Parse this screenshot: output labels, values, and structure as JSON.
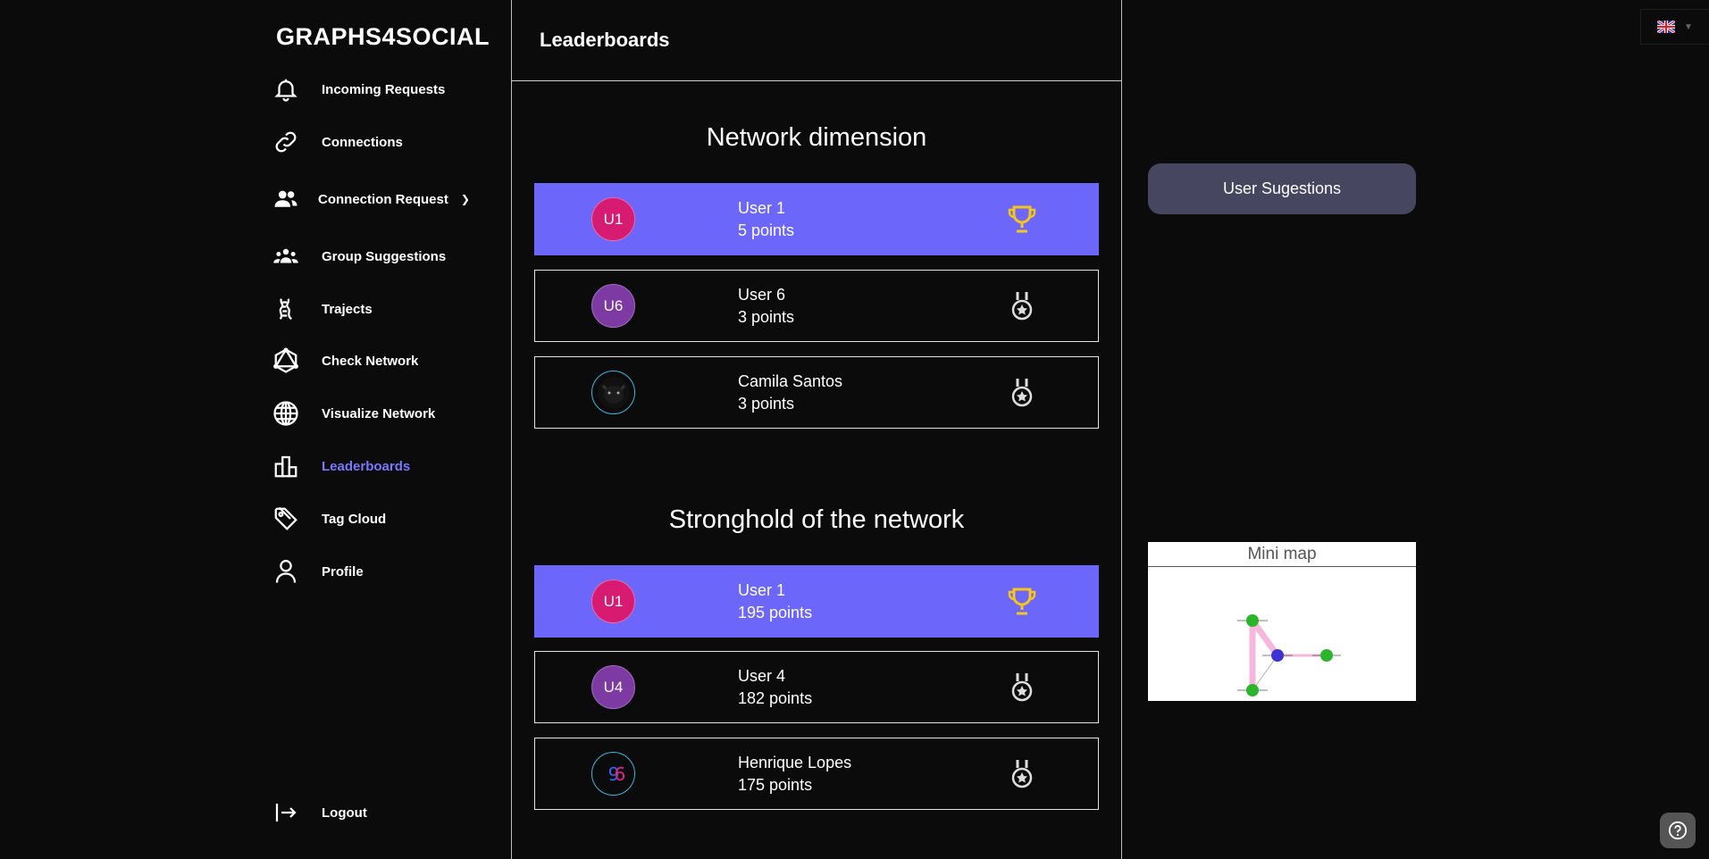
{
  "app": {
    "brand": "GRAPHS4SOCIAL"
  },
  "sidebar": {
    "items": [
      {
        "label": "Incoming Requests",
        "icon": "bell-icon"
      },
      {
        "label": "Connections",
        "icon": "link-icon"
      },
      {
        "label": "Connection Request",
        "icon": "users-icon"
      },
      {
        "label": "Group Suggestions",
        "icon": "group-icon"
      },
      {
        "label": "Trajects",
        "icon": "traject-icon"
      },
      {
        "label": "Check Network",
        "icon": "network-icon"
      },
      {
        "label": "Visualize Network",
        "icon": "globe-icon"
      },
      {
        "label": "Leaderboards",
        "icon": "leaderboard-icon"
      },
      {
        "label": "Tag Cloud",
        "icon": "tag-icon"
      },
      {
        "label": "Profile",
        "icon": "person-icon"
      }
    ],
    "active": "Leaderboards",
    "logout": "Logout"
  },
  "main": {
    "title": "Leaderboards",
    "sections": [
      {
        "title": "Network dimension",
        "entries": [
          {
            "initials": "U1",
            "name": "User 1",
            "points": "5 points",
            "badge": "trophy-icon"
          },
          {
            "initials": "U6",
            "name": "User 6",
            "points": "3 points",
            "badge": "medal-icon"
          },
          {
            "initials": "",
            "name": "Camila Santos",
            "points": "3 points",
            "badge": "medal-icon"
          }
        ]
      },
      {
        "title": "Stronghold of the network",
        "entries": [
          {
            "initials": "U1",
            "name": "User 1",
            "points": "195 points",
            "badge": "trophy-icon"
          },
          {
            "initials": "U4",
            "name": "User 4",
            "points": "182 points",
            "badge": "medal-icon"
          },
          {
            "initials": "",
            "name": "Henrique Lopes",
            "points": "175 points",
            "badge": "medal-icon"
          }
        ]
      }
    ]
  },
  "right": {
    "suggestions_button": "User Sugestions",
    "minimap_title": "Mini map"
  },
  "colors": {
    "accent": "#6c66fb",
    "active_nav": "#7b77ff",
    "trophy": "#f5c518",
    "avatar_u1": "#d81b72",
    "avatar_u6": "#7d3aa3"
  }
}
